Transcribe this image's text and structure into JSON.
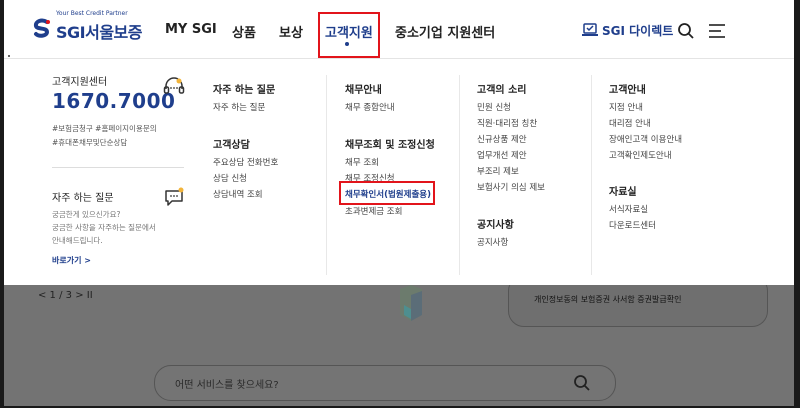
{
  "brand": {
    "tagline": "Your Best Credit Partner",
    "name": "SGI서울보증",
    "color": "#1f3e8c"
  },
  "nav": {
    "items": [
      {
        "label": "MY SGI"
      },
      {
        "label": "상품"
      },
      {
        "label": "보상"
      },
      {
        "label": "고객지원",
        "active": true
      },
      {
        "label": "중소기업 지원센터"
      }
    ],
    "direct_label": "SGI 다이렉트"
  },
  "mega_menu": {
    "contact": {
      "title": "고객지원센터",
      "phone": "1670.7000",
      "tags": [
        "#보험금청구 #홈페이지이용문의",
        "#휴대폰채무및단순상담"
      ]
    },
    "faq_panel": {
      "title": "자주 하는 질문",
      "desc": [
        "궁금한게 있으신가요?",
        "궁금한 사항을 자주하는 질문에서",
        "안내해드립니다."
      ],
      "link": "바로가기 >"
    },
    "columns": [
      {
        "groups": [
          {
            "heading": "자주 하는 질문",
            "items": [
              "자주 하는 질문"
            ]
          },
          {
            "heading": "고객상담",
            "items": [
              "주요상담 전화번호",
              "상담 신청",
              "상담내역 조회"
            ]
          }
        ]
      },
      {
        "groups": [
          {
            "heading": "채무안내",
            "items": [
              "채무 종합안내"
            ]
          },
          {
            "heading": "채무조회 및 조정신청",
            "items": [
              "채무 조회",
              "채무 조정신청",
              "채무확인서(법원제출용)",
              "초과변제금 조회"
            ]
          }
        ]
      },
      {
        "groups": [
          {
            "heading": "고객의 소리",
            "items": [
              "민원 신청",
              "직원·대리점 칭찬",
              "신규상품 제안",
              "업무개선 제안",
              "부조리 제보",
              "보험사기 의심 제보"
            ]
          },
          {
            "heading": "공지사항",
            "items": [
              "공지사항"
            ]
          }
        ]
      },
      {
        "groups": [
          {
            "heading": "고객안내",
            "items": [
              "지점 안내",
              "대리점 안내",
              "장애인고객 이용안내",
              "고객확인제도안내"
            ]
          },
          {
            "heading": "자료실",
            "items": [
              "서식자료실",
              "다운로드센터"
            ]
          }
        ]
      }
    ]
  },
  "background": {
    "pager": "<   1 / 3   >   II",
    "banner_links": "개인정보동의   보험증권 사서함   증권발급확인",
    "search_placeholder": "어떤 서비스를 찾으세요?"
  },
  "highlight_color": "#e2141b"
}
